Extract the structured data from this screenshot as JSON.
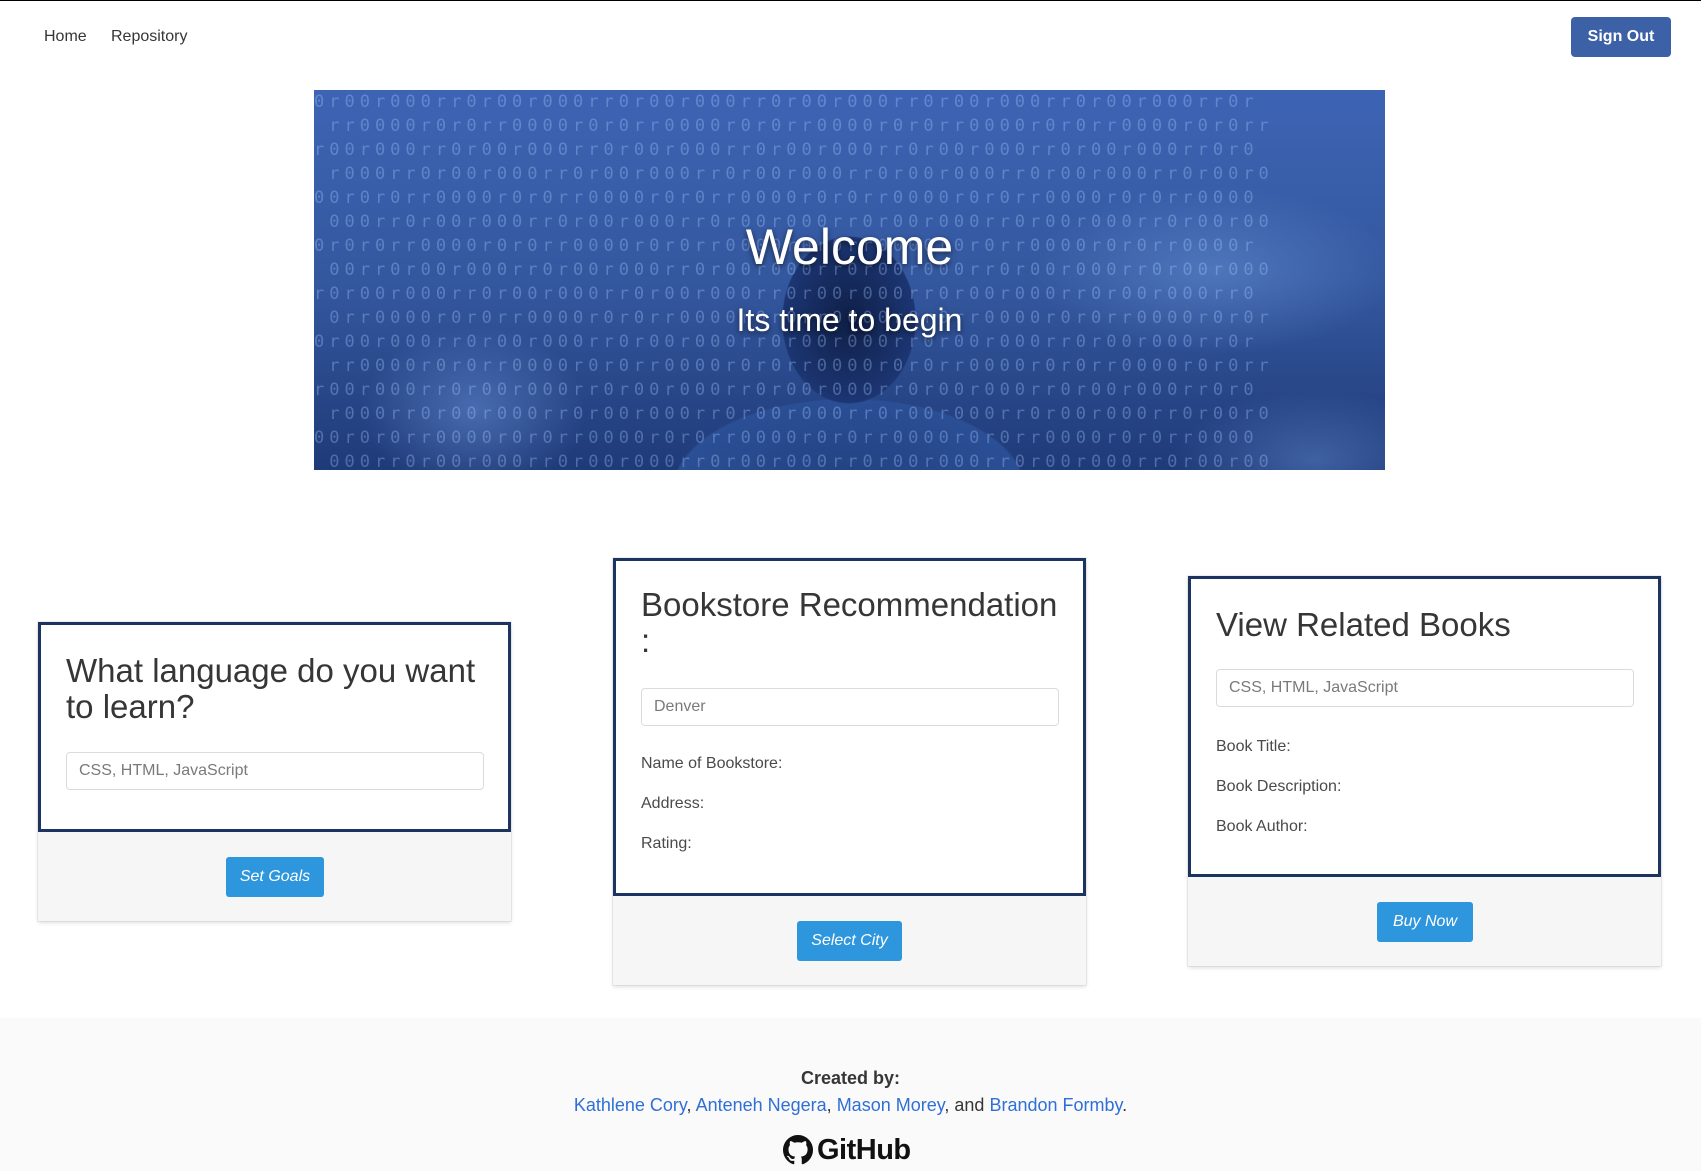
{
  "nav": {
    "home_label": "Home",
    "repository_label": "Repository",
    "signout_label": "Sign Out"
  },
  "hero": {
    "title": "Welcome",
    "subtitle": "Its time to begin"
  },
  "cards": {
    "language": {
      "title": "What language do you want to learn?",
      "input_placeholder": "CSS, HTML, JavaScript",
      "input_value": "",
      "button_label": "Set Goals"
    },
    "bookstore": {
      "title": "Bookstore Recommendation :",
      "input_placeholder": "Denver",
      "input_value": "",
      "fields": {
        "name": "Name of Bookstore:",
        "address": "Address:",
        "rating": "Rating:"
      },
      "button_label": "Select City"
    },
    "books": {
      "title": "View Related Books",
      "input_placeholder": "CSS, HTML, JavaScript",
      "input_value": "",
      "fields": {
        "title": "Book Title:",
        "description": "Book Description:",
        "author": "Book Author:"
      },
      "button_label": "Buy Now"
    }
  },
  "footer": {
    "created_by": "Created by:",
    "authors": [
      "Kathlene Cory",
      "Anteneh Negera",
      "Mason Morey",
      "Brandon Formby"
    ],
    "separator_comma": ", ",
    "separator_and": ", and ",
    "end_period": ".",
    "github_label": "GitHub"
  },
  "colors": {
    "signout_button": "#3c61a6",
    "card_border": "#1d3461",
    "action_button": "#2d96dc",
    "link": "#2f6fd6"
  },
  "icons": {
    "github": "github-octocat-icon"
  }
}
